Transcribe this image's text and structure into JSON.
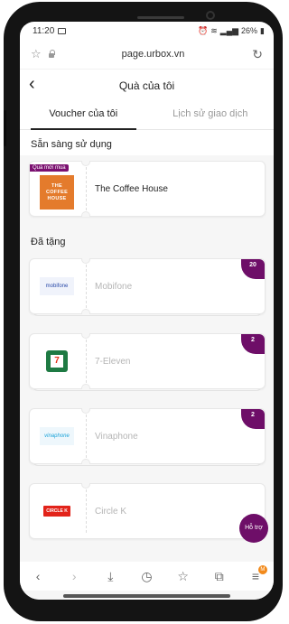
{
  "status": {
    "time": "11:20",
    "battery": "26%"
  },
  "browser": {
    "url": "page.urbox.vn"
  },
  "header": {
    "title": "Quà của tôi"
  },
  "tabs": [
    {
      "label": "Voucher của tôi",
      "active": true
    },
    {
      "label": "Lịch sử giao dịch",
      "active": false
    }
  ],
  "sections": {
    "ready": "Sẵn sàng sử dụng",
    "given": "Đã tặng"
  },
  "ready_voucher": {
    "badge": "Quà mới mua",
    "brand": "The Coffee House",
    "logo_lines": [
      "THE",
      "COFFEE",
      "HOUSE"
    ]
  },
  "given_vouchers": [
    {
      "brand": "Mobifone",
      "count": "20",
      "logo": "mobifone"
    },
    {
      "brand": "7-Eleven",
      "count": "2",
      "logo": "7"
    },
    {
      "brand": "Vinaphone",
      "count": "2",
      "logo": "vinaphone"
    },
    {
      "brand": "Circle K",
      "count": "",
      "logo": "CIRCLE K"
    }
  ],
  "support": {
    "label": "Hỗ trợ"
  },
  "bottom_nav": {
    "badge": "M"
  },
  "colors": {
    "accent": "#6e0e68",
    "coffee": "#e47b2c"
  }
}
